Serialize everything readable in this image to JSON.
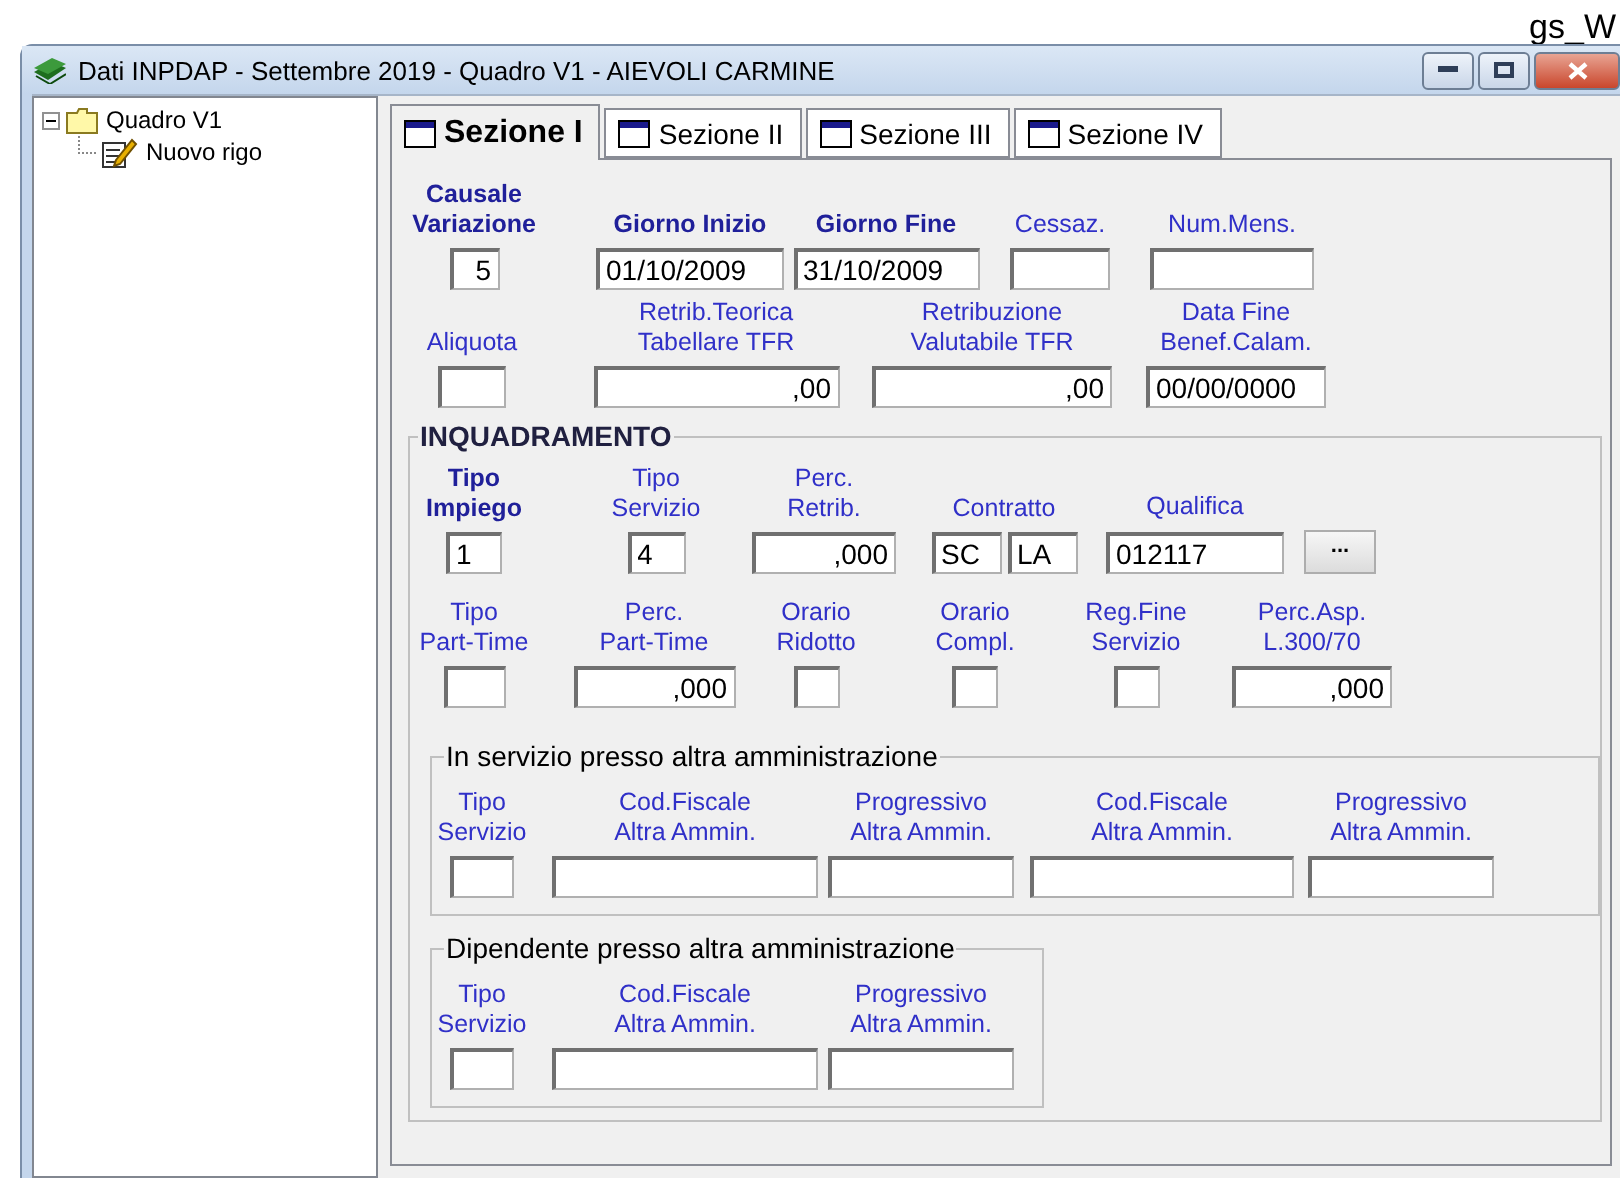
{
  "corner_text": "gs_W",
  "window": {
    "title": "Dati INPDAP - Settembre 2019 - Quadro V1 - AIEVOLI CARMINE"
  },
  "tree": [
    {
      "label": "Quadro V1",
      "expanded": true,
      "children": [
        {
          "label": "Nuovo rigo"
        }
      ]
    }
  ],
  "tabs": [
    {
      "label": "Sezione I",
      "selected": true
    },
    {
      "label": "Sezione II",
      "selected": false
    },
    {
      "label": "Sezione III",
      "selected": false
    },
    {
      "label": "Sezione IV",
      "selected": false
    }
  ],
  "section": {
    "rows": [
      {
        "fields": [
          {
            "label": "Causale\nVariazione",
            "required": true,
            "values": [
              "5"
            ]
          },
          {
            "label": "Giorno Inizio",
            "required": true,
            "values": [
              "01/10/2009"
            ]
          },
          {
            "label": "Giorno Fine",
            "required": true,
            "values": [
              "31/10/2009"
            ]
          },
          {
            "label": "Cessaz.",
            "required": false
          },
          {
            "label": "Num.Mens.",
            "required": false
          }
        ]
      },
      {
        "fields": [
          {
            "label": "Aliquota",
            "required": false
          },
          {
            "label": "Retrib.Teorica\nTabellare TFR",
            "required": false,
            "values": [
              ",00"
            ]
          },
          {
            "label": "Retribuzione\nValutabile TFR",
            "required": false,
            "values": [
              ",00"
            ]
          },
          {
            "label": "Data Fine\nBenef.Calam.",
            "required": false,
            "values": [
              "00/00/0000"
            ]
          }
        ]
      }
    ]
  },
  "inquadramento": {
    "title": "INQUADRAMENTO",
    "rows": [
      {
        "fields": [
          {
            "label": "Tipo\nImpiego",
            "required": true,
            "values": [
              "1"
            ]
          },
          {
            "label": "Tipo\nServizio",
            "required": false,
            "values": [
              "4"
            ]
          },
          {
            "label": "Perc.\nRetrib.",
            "required": false,
            "values": [
              ",000"
            ]
          },
          {
            "label": "Contratto",
            "required": false,
            "values": [
              "SC",
              "LA"
            ]
          },
          {
            "label": "Qualifica",
            "required": false,
            "values": [
              "012117"
            ],
            "button": "..."
          }
        ]
      },
      {
        "fields": [
          {
            "label": "Tipo\nPart-Time",
            "required": false
          },
          {
            "label": "Perc.\nPart-Time",
            "required": false,
            "values": [
              ",000"
            ]
          },
          {
            "label": "Orario\nRidotto",
            "required": false
          },
          {
            "label": "Orario\nCompl.",
            "required": false
          },
          {
            "label": "Reg.Fine\nServizio",
            "required": false
          },
          {
            "label": "Perc.Asp.\nL.300/70",
            "required": false,
            "values": [
              ",000"
            ]
          }
        ]
      }
    ]
  },
  "groups": [
    {
      "title": "In servizio presso altra amministrazione",
      "fields": [
        {
          "label": "Tipo\nServizio",
          "required": false
        },
        {
          "label": "Cod.Fiscale\nAltra Ammin.",
          "required": false
        },
        {
          "label": "Progressivo\nAltra Ammin.",
          "required": false
        },
        {
          "label": "Cod.Fiscale\nAltra Ammin.",
          "required": false
        },
        {
          "label": "Progressivo\nAltra Ammin.",
          "required": false
        }
      ]
    },
    {
      "title": "Dipendente presso altra amministrazione",
      "fields": [
        {
          "label": "Tipo\nServizio",
          "required": false
        },
        {
          "label": "Cod.Fiscale\nAltra Ammin.",
          "required": false
        },
        {
          "label": "Progressivo\nAltra Ammin.",
          "required": false
        }
      ]
    }
  ]
}
